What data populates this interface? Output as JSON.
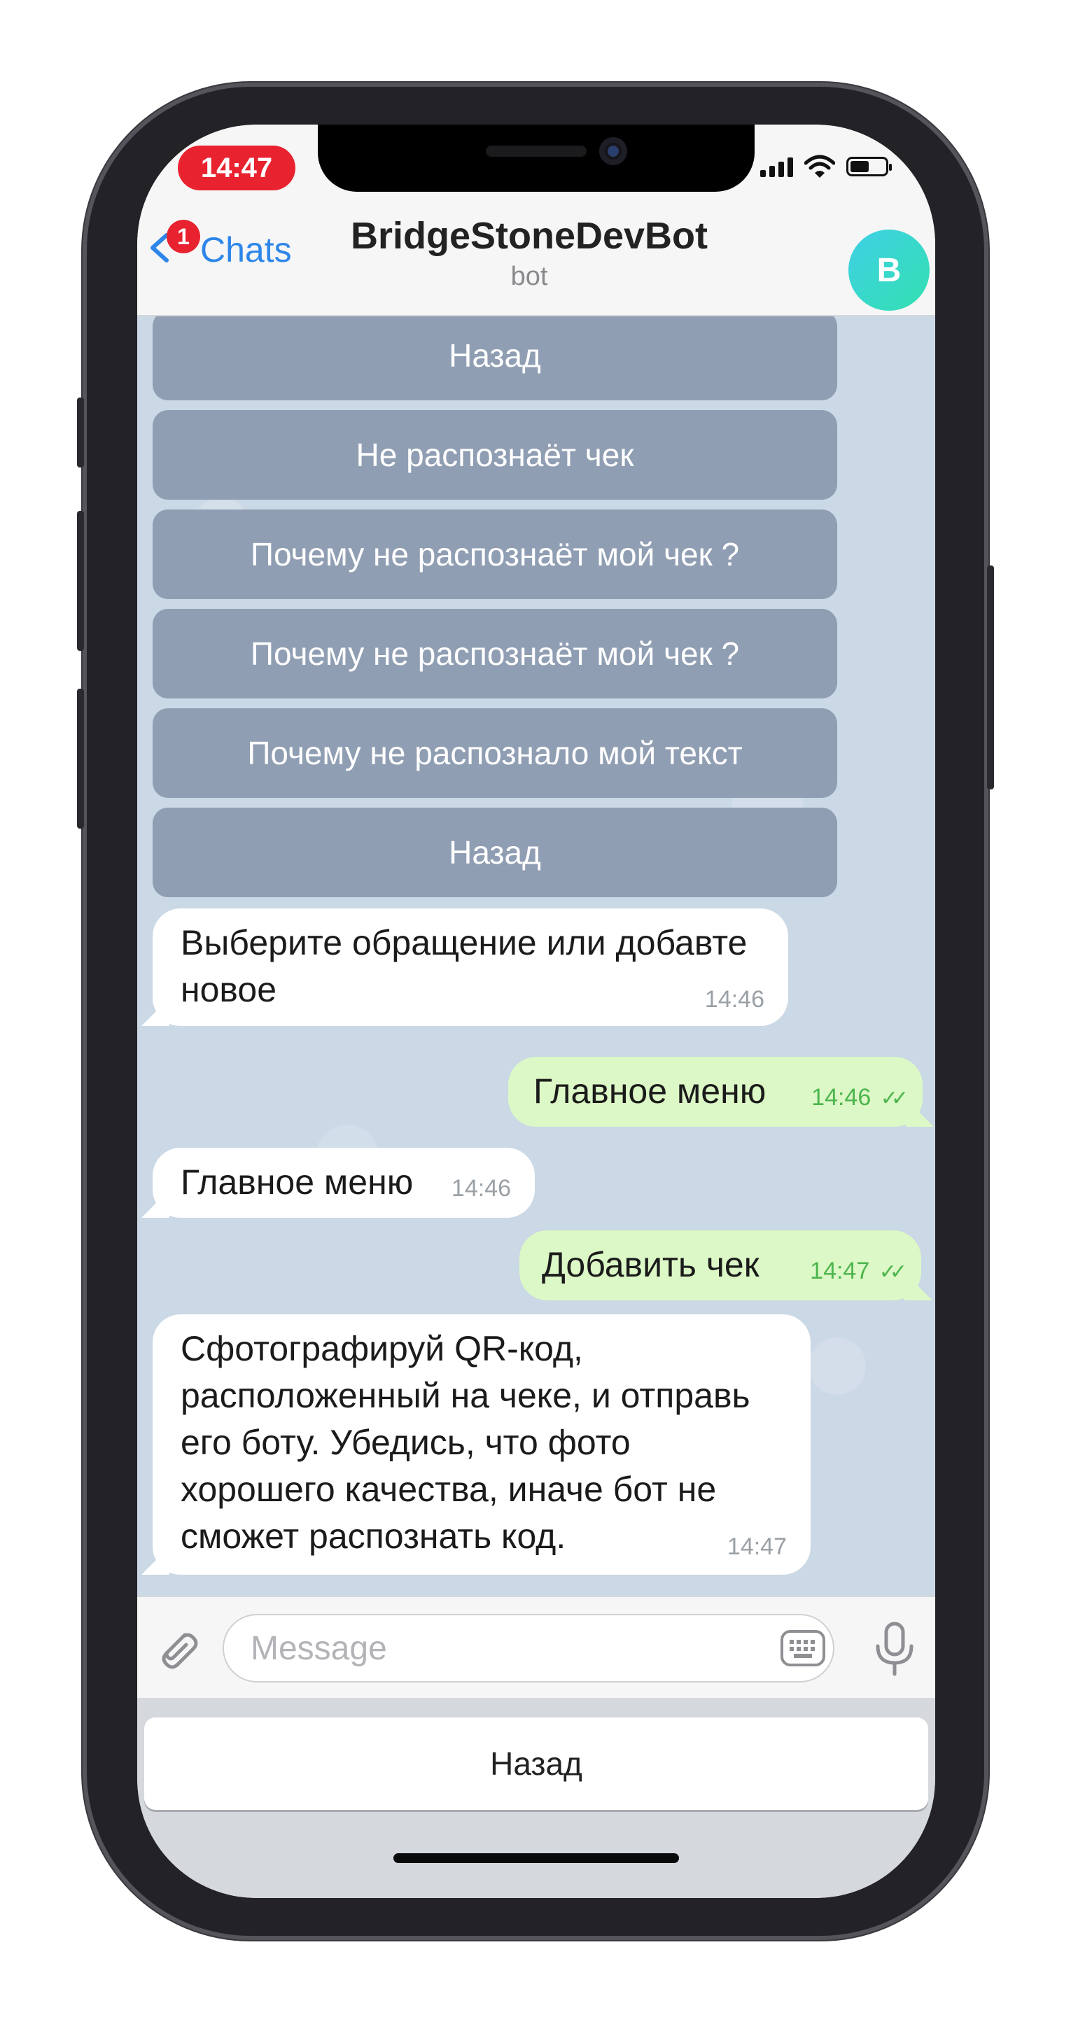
{
  "status_bar": {
    "time": "14:47",
    "icons": [
      "signal-icon",
      "wifi-icon",
      "battery-icon"
    ]
  },
  "header": {
    "back_label": "Chats",
    "unread_badge": "1",
    "title": "BridgeStoneDevBot",
    "subtitle": "bot",
    "avatar_letter": "B"
  },
  "inline_keyboard": {
    "buttons": [
      "Назад",
      "Не распознаёт чек",
      "Почему не распознаёт мой чек ?",
      "Почему не распознаёт мой чек ?",
      "Почему не распознало мой текст",
      "Назад"
    ]
  },
  "messages": [
    {
      "direction": "in",
      "text": "Выберите обращение или добавте\nновое",
      "time": "14:46"
    },
    {
      "direction": "out",
      "text": "Главное меню",
      "time": "14:46",
      "read": true
    },
    {
      "direction": "in",
      "text": "Главное меню",
      "time": "14:46"
    },
    {
      "direction": "out",
      "text": "Добавить чек",
      "time": "14:47",
      "read": true
    },
    {
      "direction": "in",
      "text": "Сфотографируй QR-код,\nрасположенный на чеке, и отправь\nего боту. Убедись, что фото\nхорошего качества, иначе бот не\nсможет распознать код.",
      "time": "14:47"
    }
  ],
  "input": {
    "placeholder": "Message"
  },
  "reply_keyboard": {
    "button": "Назад"
  },
  "colors": {
    "accent": "#2d86e8",
    "badge": "#e8232f",
    "outgoing_bubble": "#dcf8c6",
    "chat_background": "#cbd8e6",
    "inline_button": "#909eb3"
  }
}
